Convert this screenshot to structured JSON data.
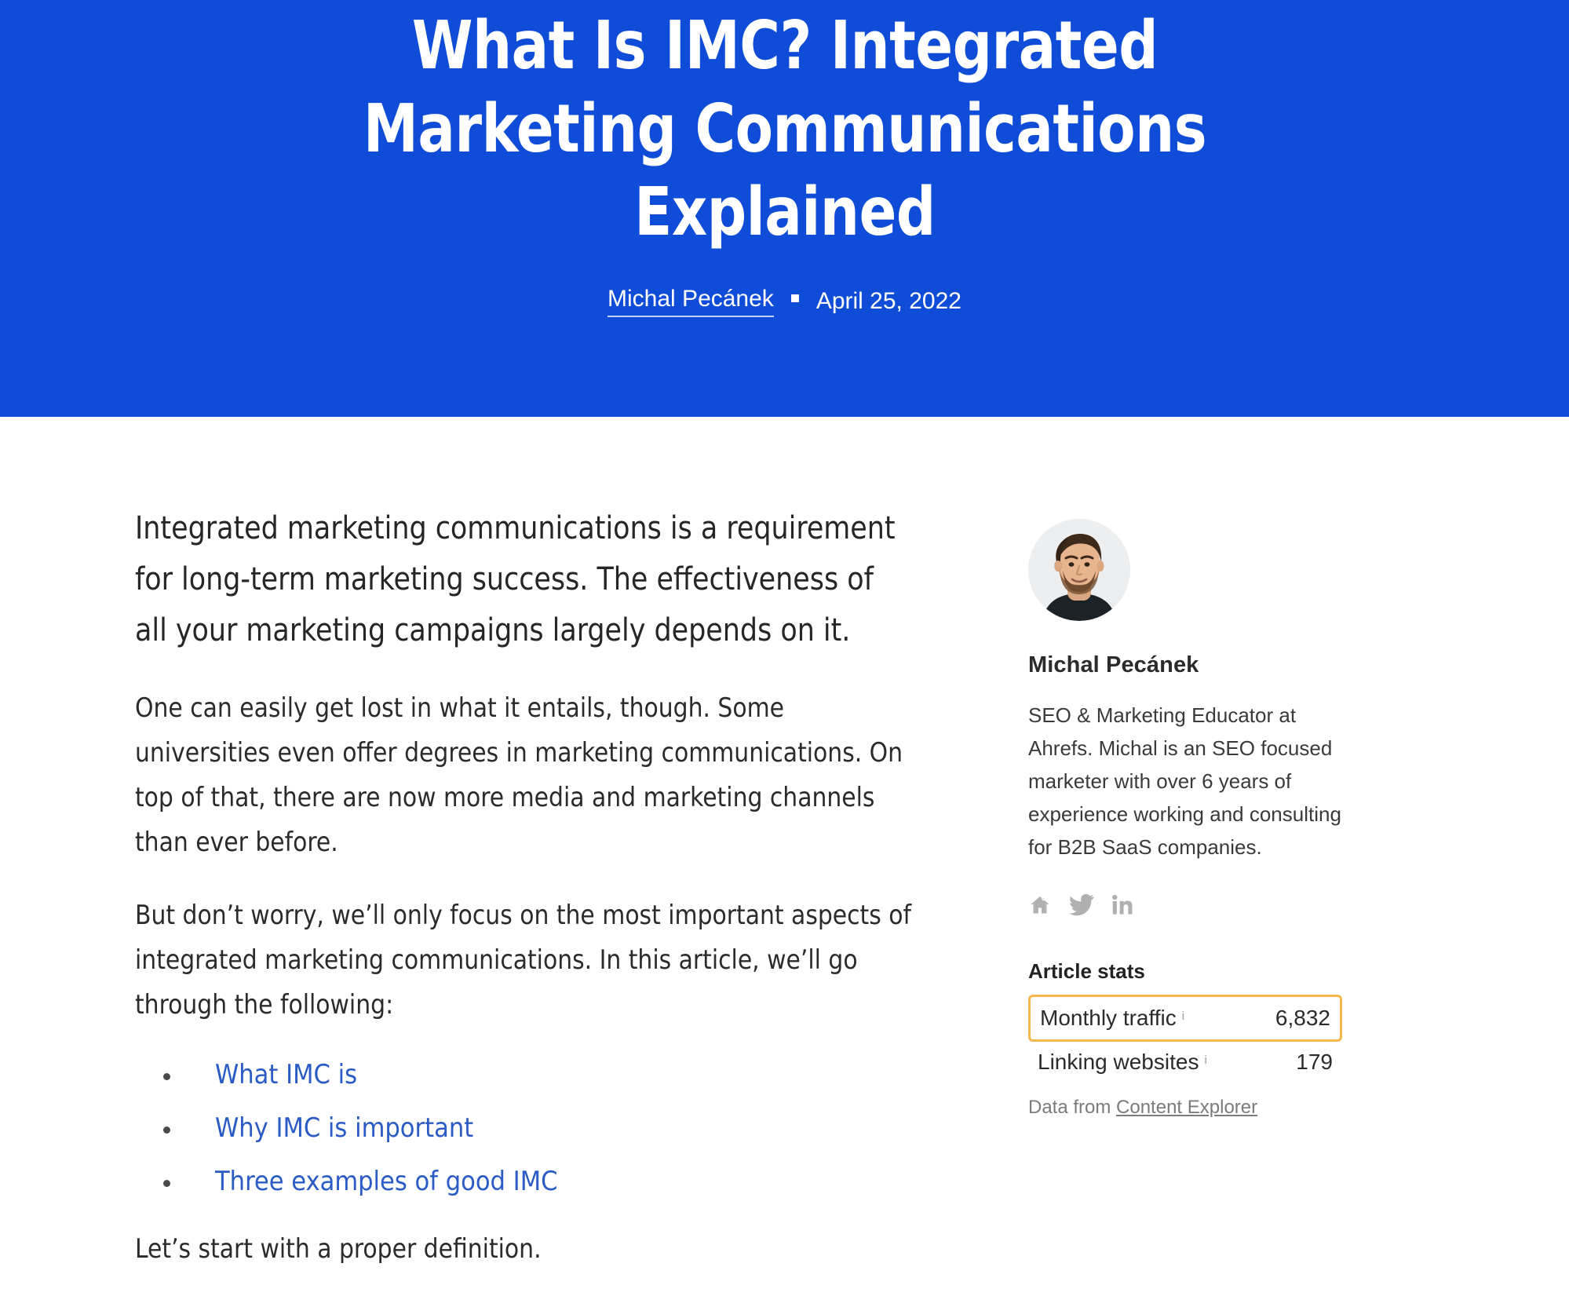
{
  "hero": {
    "title": "What Is IMC? Integrated Marketing Communications Explained",
    "author": "Michal Pecánek",
    "separator": "▪",
    "date": "April 25, 2022"
  },
  "article": {
    "lead": "Integrated marketing communications is a requirement for long-term marketing success. The effectiveness of all your marketing campaigns largely depends on it.",
    "paragraph_2": "One can easily get lost in what it entails, though. Some universities even offer degrees in marketing communications. On top of that, there are now more media and marketing channels than ever before.",
    "paragraph_3": "But don’t worry, we’ll only focus on the most important aspects of integrated marketing communications. In this article, we’ll go through the following:",
    "toc": [
      {
        "label": "What IMC is"
      },
      {
        "label": "Why IMC is important"
      },
      {
        "label": "Three examples of good IMC"
      }
    ],
    "closing": "Let’s start with a proper definition."
  },
  "sidebar": {
    "author_name": "Michal Pecánek",
    "author_bio": "SEO & Marketing Educator at Ahrefs. Michal is an SEO focused marketer with over 6 years of experience working and consulting for B2B SaaS companies.",
    "socials": [
      {
        "icon": "home-icon"
      },
      {
        "icon": "twitter-icon"
      },
      {
        "icon": "linkedin-icon"
      }
    ],
    "stats": {
      "title": "Article stats",
      "rows": [
        {
          "label": "Monthly traffic",
          "value": "6,832",
          "info": "i",
          "highlighted": true
        },
        {
          "label": "Linking websites",
          "value": "179",
          "info": "i",
          "highlighted": false
        }
      ],
      "source_prefix": "Data from ",
      "source_link": "Content Explorer"
    }
  },
  "colors": {
    "hero_background": "#0F4CD8",
    "link_blue": "#2B5BC4",
    "highlight_orange": "#F5B74E",
    "body_text": "#2b2b2b",
    "muted_text": "#7b7b7b"
  }
}
